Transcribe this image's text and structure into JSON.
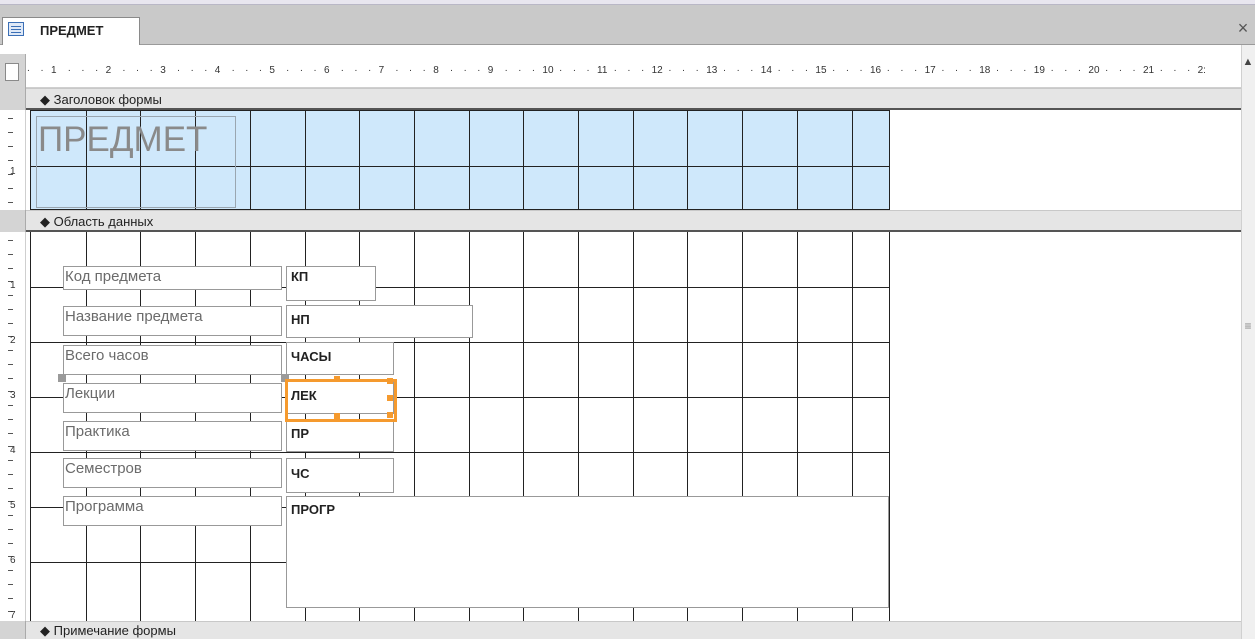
{
  "tab": {
    "title": "ПРЕДМЕТ",
    "close_glyph": "×"
  },
  "ruler": {
    "horizontal_numbers": [
      "1",
      "2",
      "3",
      "4",
      "5",
      "6",
      "7",
      "8",
      "9",
      "10",
      "11",
      "12",
      "13",
      "14",
      "15",
      "16",
      "17",
      "18",
      "19",
      "20",
      "21",
      "2:"
    ],
    "header_numbers": [
      "1"
    ],
    "detail_numbers": [
      "1",
      "2",
      "3",
      "4",
      "5",
      "6",
      "7"
    ]
  },
  "sections": {
    "header_label": "Заголовок формы",
    "detail_label": "Область данных",
    "footer_label": "Примечание формы",
    "marker_glyph": "◆"
  },
  "form_title": "ПРЕДМЕТ",
  "fields": [
    {
      "label": "Код предмета",
      "control": "КП"
    },
    {
      "label": "Название предмета",
      "control": "НП"
    },
    {
      "label": "Всего часов",
      "control": "ЧАСЫ"
    },
    {
      "label": "Лекции",
      "control": "ЛЕК"
    },
    {
      "label": "Практика",
      "control": "ПР"
    },
    {
      "label": "Семестров",
      "control": "ЧС"
    },
    {
      "label": "Программа",
      "control": "ПРОГР"
    }
  ],
  "colors": {
    "header_bg": "#cfe8fb",
    "selection": "#f59a2e",
    "grid": "#222222"
  },
  "selected_control": "ЛЕК"
}
